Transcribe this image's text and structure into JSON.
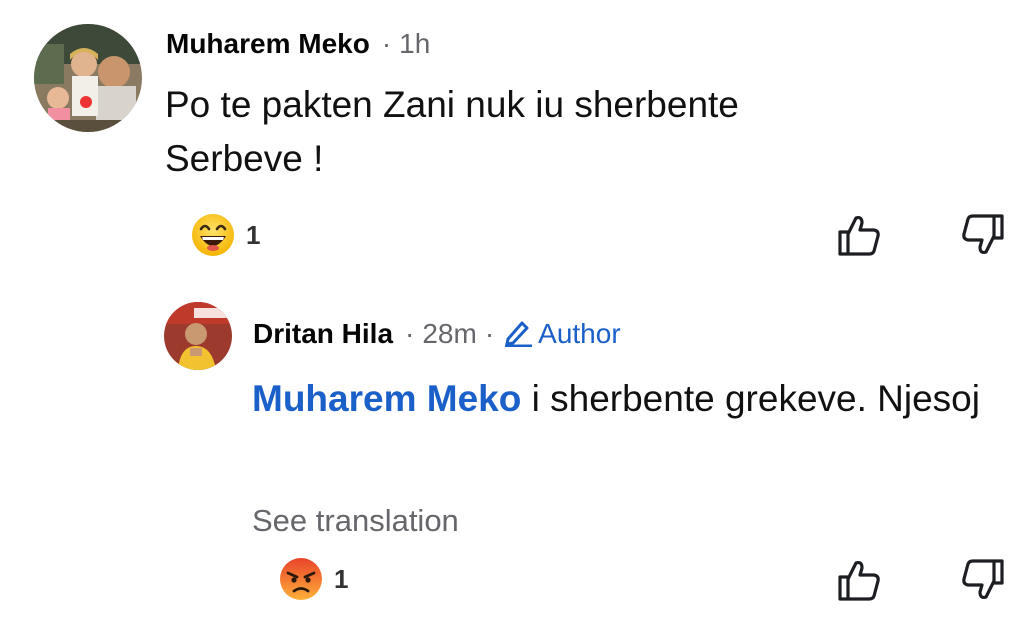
{
  "comment": {
    "author": "Muharem Meko",
    "separator": "·",
    "time": "1h",
    "text": "Po te pakten Zani nuk iu sherbente Serbeve !",
    "reaction": {
      "emoji": "grinning-squint-icon",
      "count": "1"
    }
  },
  "reply": {
    "author": "Dritan Hila",
    "separator": "·",
    "time": "28m",
    "separator2": "·",
    "badge": "Author",
    "mention": "Muharem Meko",
    "text": " i sherbente grekeve. Njesoj",
    "see_translation": "See translation",
    "reaction": {
      "emoji": "angry-face-icon",
      "count": "1"
    }
  },
  "colors": {
    "name_text": "#050505",
    "meta_text": "#65676b",
    "mention_blue": "#1b5fc9",
    "reaction_yellow": "#ffcc33",
    "reaction_angry_top": "#ef4b2f"
  }
}
